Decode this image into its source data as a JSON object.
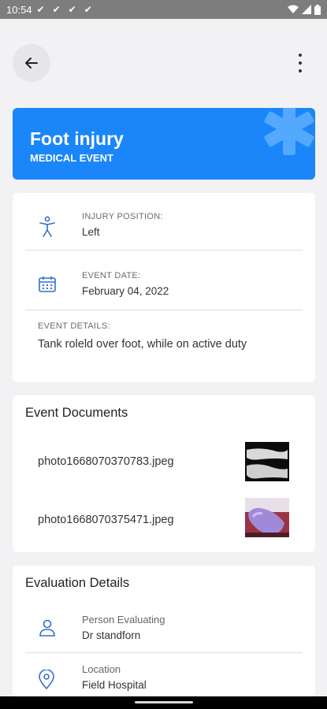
{
  "status_bar": {
    "time": "10:54",
    "notifications": [
      "check-mark-icon",
      "check-mark-icon",
      "check-mark-icon",
      "check-mark-icon"
    ]
  },
  "app_bar": {
    "back_icon": "arrow-left-icon",
    "more_icon": "more-vert-icon"
  },
  "event": {
    "title": "Foot injury",
    "category": "MEDICAL EVENT",
    "injury_position_label": "INJURY POSITION:",
    "injury_position": "Left",
    "event_date_label": "EVENT DATE:",
    "event_date": "February 04, 2022",
    "event_details_label": "EVENT DETAILS:",
    "event_details": "Tank roleld over foot, while on active duty"
  },
  "documents": {
    "title": "Event Documents",
    "items": [
      {
        "name": "photo1668070370783.jpeg"
      },
      {
        "name": "photo1668070375471.jpeg"
      }
    ]
  },
  "evaluation": {
    "title": "Evaluation Details",
    "person_label": "Person Evaluating",
    "person": "Dr standforn",
    "location_label": "Location",
    "location": "Field Hospital"
  },
  "colors": {
    "accent": "#1a86f9",
    "icon": "#2f6fd1"
  }
}
